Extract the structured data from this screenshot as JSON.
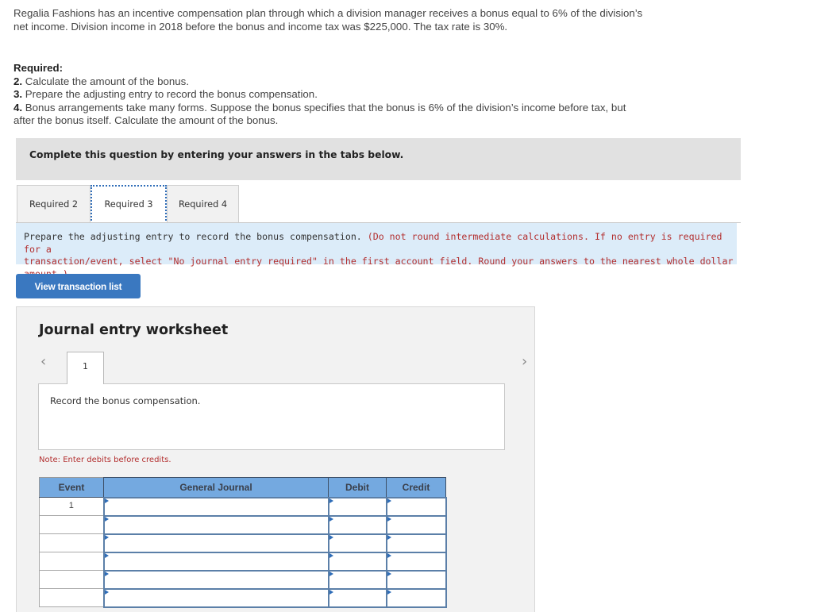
{
  "intro": {
    "line1": "Regalia Fashions has an incentive compensation plan through which a division manager receives a bonus equal to 6% of the division’s",
    "line2": "net income. Division income in 2018 before the bonus and income tax was $225,000. The tax rate is 30%."
  },
  "required": {
    "title": "Required:",
    "items": [
      {
        "num": "2.",
        "text": " Calculate the amount of the bonus."
      },
      {
        "num": "3.",
        "text": " Prepare the adjusting entry to record the bonus compensation."
      },
      {
        "num": "4.",
        "text": " Bonus arrangements take many forms. Suppose the bonus specifies that the bonus is 6% of the division’s income before tax, but",
        "text2": "after the bonus itself. Calculate the amount of the bonus."
      }
    ]
  },
  "instructions": "Complete this question by entering your answers in the tabs below.",
  "tabs": [
    {
      "label": "Required 2",
      "active": false
    },
    {
      "label": "Required 3",
      "active": true
    },
    {
      "label": "Required 4",
      "active": false
    }
  ],
  "prompt": {
    "main": "Prepare the adjusting entry to record the bonus compensation. ",
    "note_line1": "(Do not round intermediate calculations. If no entry is required for a",
    "note_line2": "transaction/event, select \"No journal entry required\" in the first account field. Round your answers to the nearest whole dollar amount.)"
  },
  "view_transaction_button": "View transaction list",
  "worksheet": {
    "title": "Journal entry worksheet",
    "prev_icon": "chevron-left-icon",
    "next_icon": "chevron-right-icon",
    "current_tab": "1",
    "description": "Record the bonus compensation.",
    "note": "Note: Enter debits before credits.",
    "table": {
      "headers": [
        "Event",
        "General Journal",
        "Debit",
        "Credit"
      ],
      "rows": [
        {
          "event": "1",
          "account": "",
          "debit": "",
          "credit": ""
        },
        {
          "event": "",
          "account": "",
          "debit": "",
          "credit": ""
        },
        {
          "event": "",
          "account": "",
          "debit": "",
          "credit": ""
        },
        {
          "event": "",
          "account": "",
          "debit": "",
          "credit": ""
        },
        {
          "event": "",
          "account": "",
          "debit": "",
          "credit": ""
        },
        {
          "event": "",
          "account": "",
          "debit": "",
          "credit": ""
        }
      ]
    }
  },
  "colors": {
    "button_blue": "#3a78c0",
    "header_blue": "#74a9e0",
    "note_red": "#b32f2f",
    "prompt_bg": "#dcecf9"
  }
}
